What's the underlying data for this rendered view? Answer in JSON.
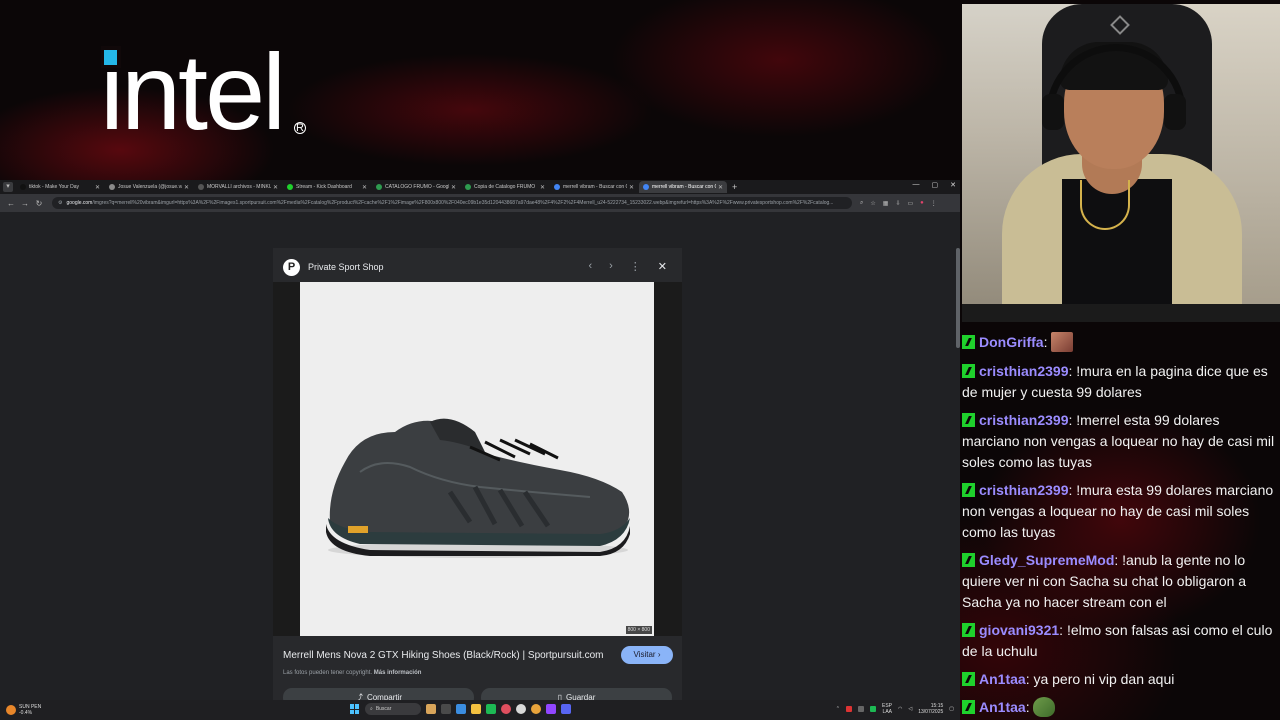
{
  "colors": {
    "accent_blue": "#8ab4f8",
    "chat_username": "#9b8cff",
    "chat_badge": "#1fd12c",
    "intel_blue": "#24b7e8"
  },
  "overlay": {
    "logo_text": "intel",
    "logo_reg": "R"
  },
  "browser": {
    "tabs": [
      {
        "title": "tiktok - Make Your Day",
        "favicon_color": "#111111",
        "active": false
      },
      {
        "title": "Josue Valenzuela (@josue.valen...",
        "favicon_color": "#8a8a8a",
        "active": false
      },
      {
        "title": "MORVALLI archivos - MINKU...",
        "favicon_color": "#555555",
        "active": false
      },
      {
        "title": "Stream - Kick Dashboard",
        "favicon_color": "#1fd12c",
        "active": false
      },
      {
        "title": "CATALOGO FRUMO - Google ...",
        "favicon_color": "#2e9b4f",
        "active": false
      },
      {
        "title": "Copia de Catalogo FRUMO",
        "favicon_color": "#2e9b4f",
        "active": false
      },
      {
        "title": "merrell vibram - Buscar con Go...",
        "favicon_color": "#4285f4",
        "active": false
      },
      {
        "title": "merrell vibram - Buscar con Go...",
        "favicon_color": "#4285f4",
        "active": true
      }
    ],
    "new_tab_icon": "plus-icon",
    "url_host": "google.com",
    "url_rest": "/imgres?q=merrell%20vibram&imgurl=https%3A%2F%2Fimages1.sportpursuit.com%2Fmedia%2Fcatalog%2Fproduct%2Fcache%2F1%2Fimage%2F800x800%2F040ec09b1e35d1204438687a97dae48%2F4%2F2%2F4Merrell_u24-5222734_15233022.webp&imgrefurl=https%3A%2F%2Fwww.privatesportshop.com%2F%2Fcatalog..."
  },
  "viewer": {
    "site_name": "Private Sport Shop",
    "site_initial": "P",
    "image_dims": "800 × 800",
    "title": "Merrell Mens Nova 2 GTX Hiking Shoes (Black/Rock) | Sportpursuit.com",
    "visit_label": "Visitar",
    "copyright_text": "Las fotos pueden tener copyright.",
    "more_info_label": "Más información",
    "share_label": "Compartir",
    "save_label": "Guardar"
  },
  "taskbar": {
    "weather_line1": "SUN PEN",
    "weather_line2": "-0.4%",
    "search_placeholder": "Buscar",
    "lang1": "ESP",
    "lang2": "LAA",
    "time": "15:15",
    "date": "13/07/2025"
  },
  "chat": {
    "messages": [
      {
        "user": "DonGriffa",
        "text": "",
        "emote": "face"
      },
      {
        "user": "cristhian2399",
        "text": "!mura en la pagina dice que es de mujer y cuesta 99 dolares"
      },
      {
        "user": "cristhian2399",
        "text": "!merrel esta 99 dolares marciano non vengas a loquear no hay de casi mil soles como las tuyas"
      },
      {
        "user": "cristhian2399",
        "text": "!mura esta 99 dolares marciano non vengas a loquear no hay de casi mil soles como las tuyas"
      },
      {
        "user": "Gledy_SupremeMod",
        "text": "!anub la gente no lo quiere ver ni con Sacha su chat lo obligaron a Sacha ya no hacer stream con el"
      },
      {
        "user": "giovani9321",
        "text": "!elmo son falsas asi como el culo de la uchulu"
      },
      {
        "user": "An1taa",
        "text": "ya pero ni vip dan aqui"
      },
      {
        "user": "An1taa",
        "text": "",
        "emote": "frog"
      }
    ]
  }
}
